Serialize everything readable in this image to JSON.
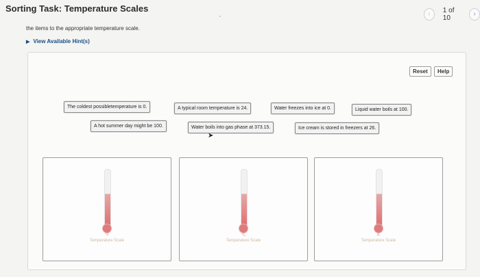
{
  "header": {
    "title": "Sorting Task: Temperature Scales",
    "pager": {
      "prev_icon": "‹",
      "count": "1 of 10",
      "next_icon": "›"
    }
  },
  "instruction": "the items to the appropriate temperature scale.",
  "hint": {
    "label": "View Available Hint(s)"
  },
  "controls": {
    "reset_label": "Reset",
    "help_label": "Help"
  },
  "items": [
    "The coldest possibletemperature is 0.",
    "A typical room temperature is 24.",
    "Water freezes into ice at 0.",
    "Liquid water boils at 100.",
    "A hot summer day might be 100.",
    "Water boils into gas phase at 373.15.",
    "Ice cream is stored in freezers at 26."
  ],
  "bins": [
    {
      "unit": "°F",
      "label": "Temperature Scale"
    },
    {
      "unit": "°C",
      "label": "Temperature Scale"
    },
    {
      "unit": "K",
      "label": "Temperature Scale"
    }
  ]
}
